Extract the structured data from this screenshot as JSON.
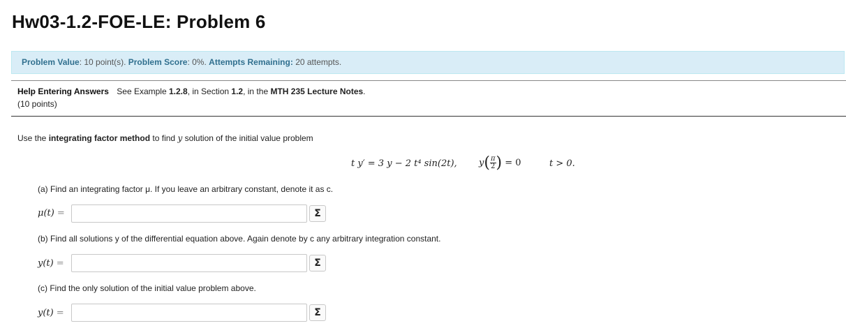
{
  "page": {
    "title": "Hw03-1.2-FOE-LE: Problem 6"
  },
  "status": {
    "value_label": "Problem Value",
    "value": ": 10 point(s).",
    "score_label": "Problem Score",
    "score": ": 0%.",
    "attempts_label": "Attempts Remaining:",
    "attempts": "20 attempts."
  },
  "help": {
    "link_label": "Help Entering Answers",
    "see": "See Example",
    "example": "1.2.8",
    "in_section": ", in Section",
    "section": "1.2",
    "in_the": ", in the",
    "notes": "MTH 235 Lecture Notes",
    "period": ".",
    "points": "(10 points)"
  },
  "problem": {
    "intro_pre": "Use the",
    "intro_bold": "integrating factor method",
    "intro_mid": "to find",
    "intro_var": "y",
    "intro_post": "solution of the initial value problem",
    "eq_main": "t y′ = 3 y − 2 t⁴ sin(2t),",
    "eq_ic_y": "y",
    "eq_ic_num": "π",
    "eq_ic_den": "2",
    "eq_ic_rhs": "= 0",
    "eq_cond": "t > 0."
  },
  "parts": [
    {
      "question": "(a) Find an integrating factor μ. If you leave an arbitrary constant, denote it as c.",
      "label": "μ(t)",
      "eq": "=",
      "value": ""
    },
    {
      "question": "(b) Find all solutions y of the differential equation above. Again denote by c any arbitrary integration constant.",
      "label": "y(t)",
      "eq": "=",
      "value": ""
    },
    {
      "question": "(c) Find the only solution of the initial value problem above.",
      "label": "y(t)",
      "eq": "=",
      "value": ""
    }
  ],
  "icons": {
    "equation_editor": "sigma-icon"
  },
  "equation_button_glyph": "Σ"
}
